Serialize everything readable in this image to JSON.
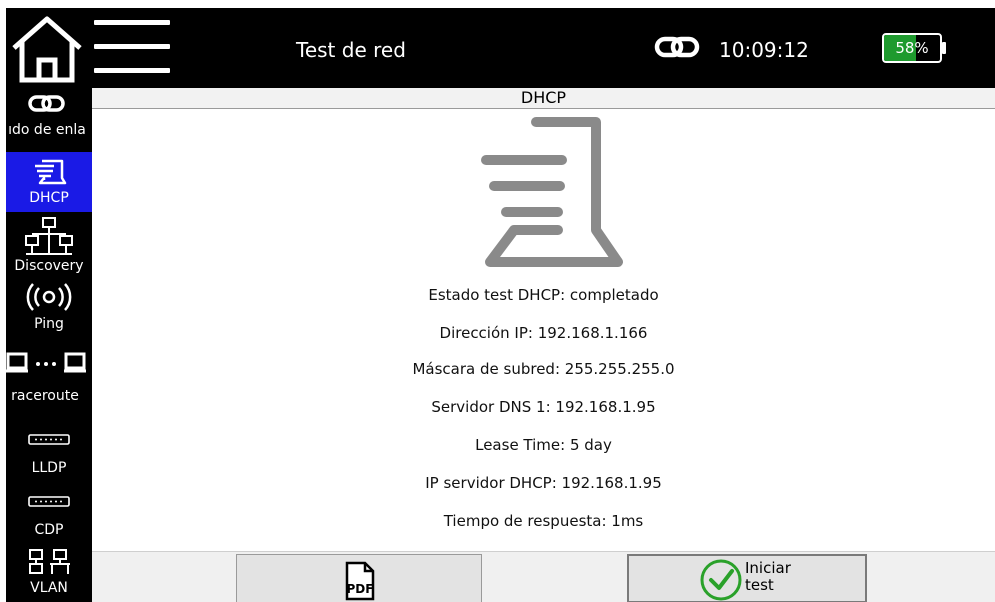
{
  "header": {
    "title": "Test de red",
    "clock": "10:09:12",
    "battery_percent": 58,
    "battery_label": "58%",
    "icons": [
      "home-icon",
      "hamburger-menu-icon",
      "link-icon",
      "battery-icon"
    ]
  },
  "sidebar": {
    "items": [
      {
        "label": "ıdo de enla",
        "icon": "link-icon",
        "active": false
      },
      {
        "label": "DHCP",
        "icon": "dhcp-icon",
        "active": true
      },
      {
        "label": "Discovery",
        "icon": "network-tree-icon",
        "active": false
      },
      {
        "label": "Ping",
        "icon": "ping-icon",
        "active": false
      },
      {
        "label": "raceroute",
        "icon": "traceroute-icon",
        "active": false
      },
      {
        "label": "LLDP",
        "icon": "switch-port-icon",
        "active": false
      },
      {
        "label": "CDP",
        "icon": "switch-port-icon",
        "active": false
      },
      {
        "label": "VLAN",
        "icon": "vlan-icon",
        "active": false
      }
    ]
  },
  "main": {
    "section_title": "DHCP",
    "big_icon": "dhcp-large-icon",
    "info_lines": [
      "Estado test DHCP: completado",
      "Dirección IP: 192.168.1.166",
      "Máscara de subred: 255.255.255.0",
      "Servidor DNS 1: 192.168.1.95",
      "Lease Time: 5 day",
      "IP servidor DHCP: 192.168.1.95",
      "Tiempo de respuesta: 1ms"
    ]
  },
  "toolbar": {
    "pdf_icon_text": "PDF",
    "start_label": "Iniciar test"
  },
  "colors": {
    "active_item": "#1a1ae6",
    "battery_fill": "#1e9a2e",
    "start_check": "#2aa12a",
    "icon_gray": "#8a8a8a"
  }
}
